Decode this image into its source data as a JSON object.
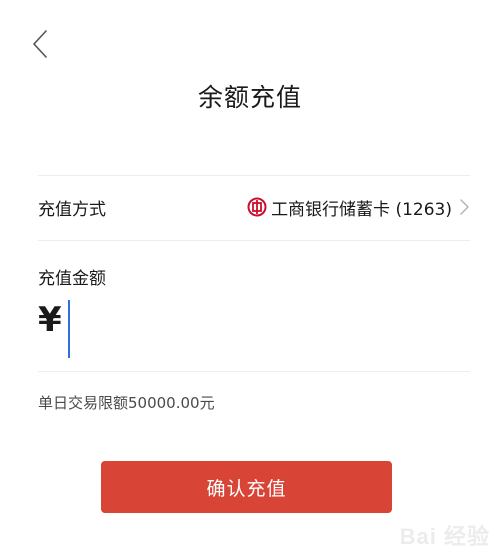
{
  "header": {
    "back_icon": "chevron-left-icon",
    "title": "余额充值"
  },
  "payment_method": {
    "label": "充值方式",
    "bank_icon": "icbc-bank-icon",
    "bank_name": "工商银行储蓄卡 (1263)",
    "chevron_icon": "chevron-right-icon"
  },
  "amount": {
    "label": "充值金额",
    "currency": "¥",
    "value": ""
  },
  "limit": {
    "text": "单日交易限额50000.00元"
  },
  "confirm_button": {
    "label": "确认充值"
  },
  "colors": {
    "accent_red": "#d84436",
    "caret_blue": "#2f6fde",
    "bank_red": "#c8102e"
  },
  "watermark": {
    "text": "Bai 经验"
  }
}
